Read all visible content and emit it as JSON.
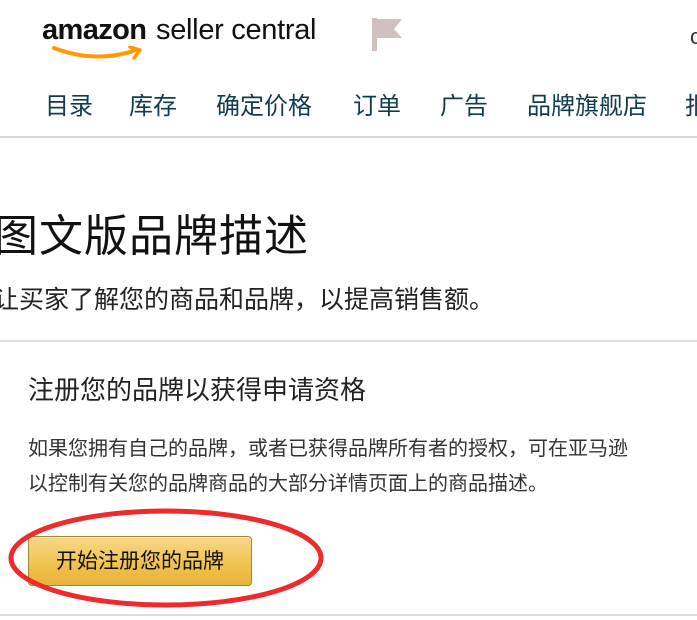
{
  "header": {
    "logo_brand": "amazon",
    "logo_suffix": "seller central",
    "corner_text": "c"
  },
  "nav": {
    "items": [
      "目录",
      "库存",
      "确定价格",
      "订单",
      "广告",
      "品牌旗舰店",
      "报"
    ]
  },
  "page": {
    "title": "图文版品牌描述",
    "subtitle": "让买家了解您的商品和品牌，以提高销售额。"
  },
  "card": {
    "title": "注册您的品牌以获得申请资格",
    "description_line1": "如果您拥有自己的品牌，或者已获得品牌所有者的授权，可在亚马逊",
    "description_line2": "以控制有关您的品牌商品的大部分详情页面上的商品描述。",
    "cta_label": "开始注册您的品牌"
  },
  "colors": {
    "nav_text": "#0f3d4f",
    "button_fill": "#f0c14b",
    "annotation_ring": "#ee2a2a",
    "smile": "#ff9900"
  },
  "icons": [
    "amazon-smile-icon",
    "flag-icon"
  ]
}
